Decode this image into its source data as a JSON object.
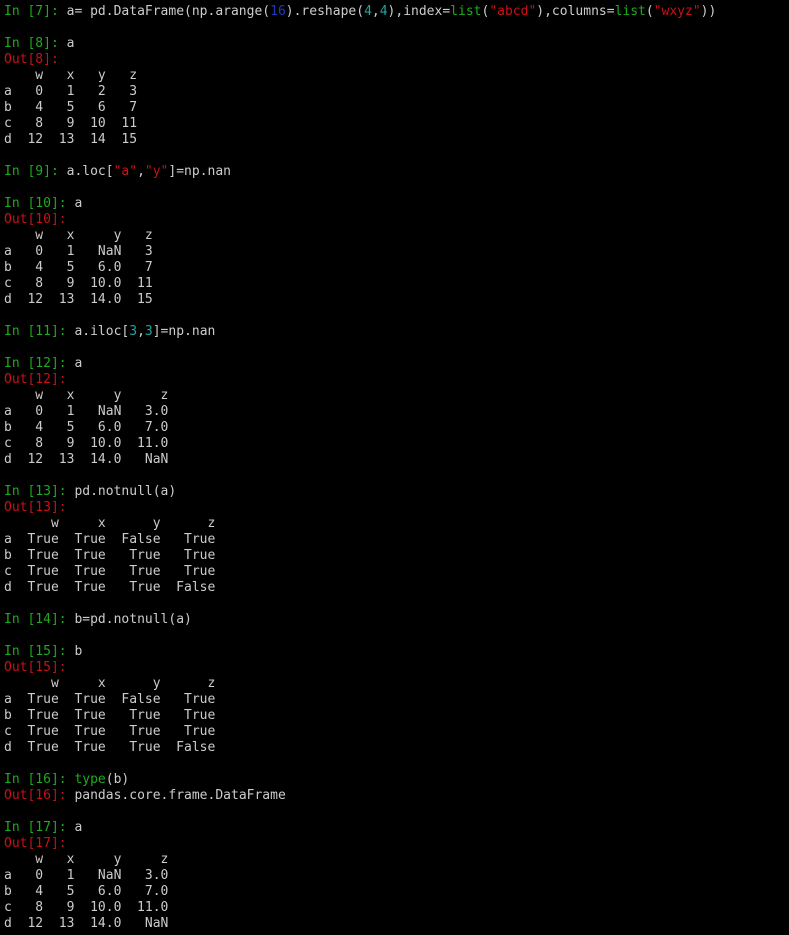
{
  "cells": {
    "in7": {
      "prompt": "In [7]: ",
      "p1": "a= pd.DataFrame(np.arange(",
      "num16": "16",
      "p2": ").reshape(",
      "num4a": "4",
      "comma1": ",",
      "num4b": "4",
      "p3": "),index=",
      "list1": "list",
      "paren1": "(",
      "str1": "\"abcd\"",
      "p4": "),columns=",
      "list2": "list",
      "paren2": "(",
      "str2": "\"wxyz\"",
      "p5": "))"
    },
    "in8": {
      "prompt": "In [8]: ",
      "code": "a"
    },
    "out8": {
      "prompt": "Out[8]:"
    },
    "df8": {
      "h": "    w   x   y   z",
      "r0": "a   0   1   2   3",
      "r1": "b   4   5   6   7",
      "r2": "c   8   9  10  11",
      "r3": "d  12  13  14  15"
    },
    "in9": {
      "prompt": "In [9]: ",
      "p1": "a.loc[",
      "str1": "\"a\"",
      "comma": ",",
      "str2": "\"y\"",
      "p2": "]=np.nan"
    },
    "in10": {
      "prompt": "In [10]: ",
      "code": "a"
    },
    "out10": {
      "prompt": "Out[10]:"
    },
    "df10": {
      "h": "    w   x     y   z",
      "r0": "a   0   1   NaN   3",
      "r1": "b   4   5   6.0   7",
      "r2": "c   8   9  10.0  11",
      "r3": "d  12  13  14.0  15"
    },
    "in11": {
      "prompt": "In [11]: ",
      "p1": "a.iloc[",
      "n1": "3",
      "comma": ",",
      "n2": "3",
      "p2": "]=np.nan"
    },
    "in12": {
      "prompt": "In [12]: ",
      "code": "a"
    },
    "out12": {
      "prompt": "Out[12]:"
    },
    "df12": {
      "h": "    w   x     y     z",
      "r0": "a   0   1   NaN   3.0",
      "r1": "b   4   5   6.0   7.0",
      "r2": "c   8   9  10.0  11.0",
      "r3": "d  12  13  14.0   NaN"
    },
    "in13": {
      "prompt": "In [13]: ",
      "code": "pd.notnull(a)"
    },
    "out13": {
      "prompt": "Out[13]:"
    },
    "df13": {
      "h": "      w     x      y      z",
      "r0": "a  True  True  False   True",
      "r1": "b  True  True   True   True",
      "r2": "c  True  True   True   True",
      "r3": "d  True  True   True  False"
    },
    "in14": {
      "prompt": "In [14]: ",
      "code": "b=pd.notnull(a)"
    },
    "in15": {
      "prompt": "In [15]: ",
      "code": "b"
    },
    "out15": {
      "prompt": "Out[15]:"
    },
    "df15": {
      "h": "      w     x      y      z",
      "r0": "a  True  True  False   True",
      "r1": "b  True  True   True   True",
      "r2": "c  True  True   True   True",
      "r3": "d  True  True   True  False"
    },
    "in16": {
      "prompt": "In [16]: ",
      "kw": "type",
      "p1": "(b)"
    },
    "out16": {
      "prompt": "Out[16]: ",
      "val": "pandas.core.frame.DataFrame"
    },
    "in17": {
      "prompt": "In [17]: ",
      "code": "a"
    },
    "out17": {
      "prompt": "Out[17]:"
    },
    "df17": {
      "h": "    w   x     y     z",
      "r0": "a   0   1   NaN   3.0",
      "r1": "b   4   5   6.0   7.0",
      "r2": "c   8   9  10.0  11.0",
      "r3": "d  12  13  14.0   NaN"
    }
  }
}
